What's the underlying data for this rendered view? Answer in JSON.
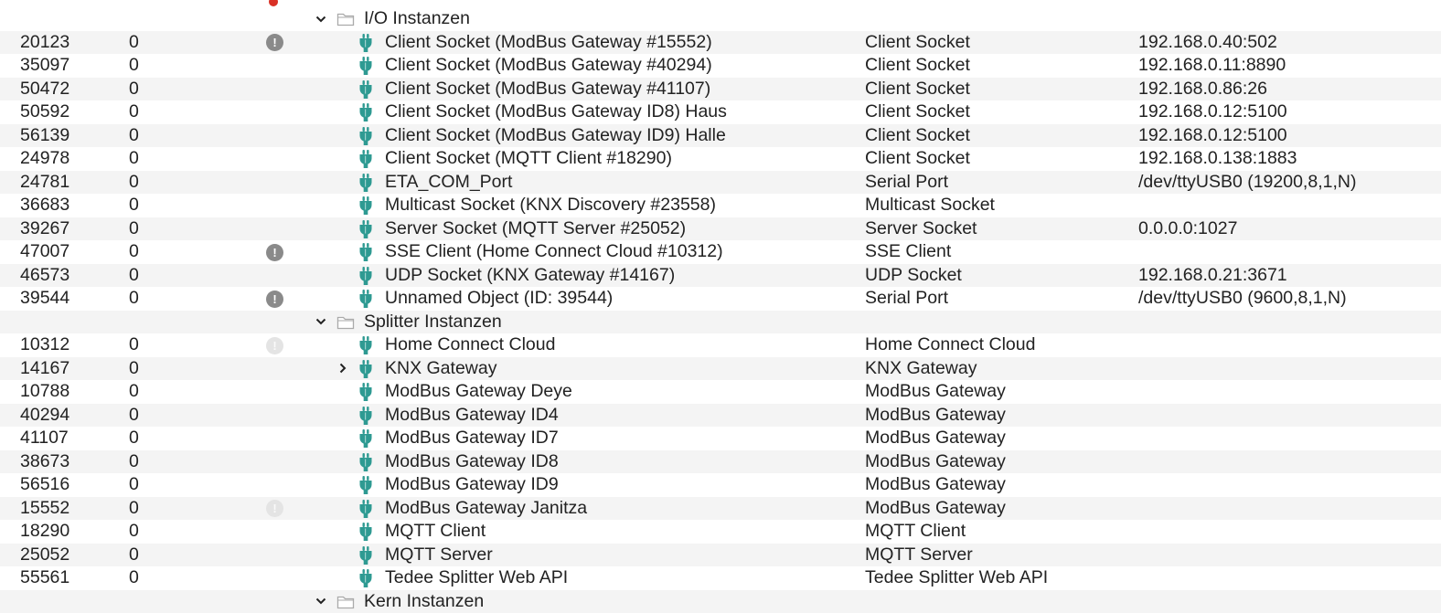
{
  "colors": {
    "plug_icon": "#2e9a92",
    "warn_icon": "#8a8a8a",
    "warn_icon_faded": "#e4e4e4",
    "row_stripe": "#f4f4f4",
    "error_dot": "#d93025"
  },
  "groups": [
    {
      "label": "I/O Instanzen",
      "expanded": true,
      "rows": [
        {
          "id": "20123",
          "count": "0",
          "status": "warning",
          "name": "Client Socket (ModBus Gateway #15552)",
          "type": "Client Socket",
          "address": "192.168.0.40:502"
        },
        {
          "id": "35097",
          "count": "0",
          "status": "none",
          "name": "Client Socket (ModBus Gateway #40294)",
          "type": "Client Socket",
          "address": "192.168.0.11:8890"
        },
        {
          "id": "50472",
          "count": "0",
          "status": "none",
          "name": "Client Socket (ModBus Gateway #41107)",
          "type": "Client Socket",
          "address": "192.168.0.86:26"
        },
        {
          "id": "50592",
          "count": "0",
          "status": "none",
          "name": "Client Socket (ModBus Gateway ID8) Haus",
          "type": "Client Socket",
          "address": "192.168.0.12:5100"
        },
        {
          "id": "56139",
          "count": "0",
          "status": "none",
          "name": "Client Socket (ModBus Gateway ID9) Halle",
          "type": "Client Socket",
          "address": "192.168.0.12:5100"
        },
        {
          "id": "24978",
          "count": "0",
          "status": "none",
          "name": "Client Socket (MQTT Client #18290)",
          "type": "Client Socket",
          "address": "192.168.0.138:1883"
        },
        {
          "id": "24781",
          "count": "0",
          "status": "none",
          "name": "ETA_COM_Port",
          "type": "Serial Port",
          "address": "/dev/ttyUSB0 (19200,8,1,N)"
        },
        {
          "id": "36683",
          "count": "0",
          "status": "none",
          "name": "Multicast Socket (KNX Discovery #23558)",
          "type": "Multicast Socket",
          "address": ""
        },
        {
          "id": "39267",
          "count": "0",
          "status": "none",
          "name": "Server Socket (MQTT Server #25052)",
          "type": "Server Socket",
          "address": "0.0.0.0:1027"
        },
        {
          "id": "47007",
          "count": "0",
          "status": "warning",
          "name": "SSE Client (Home Connect Cloud #10312)",
          "type": "SSE Client",
          "address": ""
        },
        {
          "id": "46573",
          "count": "0",
          "status": "none",
          "name": "UDP Socket (KNX Gateway #14167)",
          "type": "UDP Socket",
          "address": "192.168.0.21:3671"
        },
        {
          "id": "39544",
          "count": "0",
          "status": "warning",
          "name": "Unnamed Object (ID: 39544)",
          "type": "Serial Port",
          "address": "/dev/ttyUSB0 (9600,8,1,N)"
        }
      ]
    },
    {
      "label": "Splitter Instanzen",
      "expanded": true,
      "rows": [
        {
          "id": "10312",
          "count": "0",
          "status": "faded",
          "name": "Home Connect Cloud",
          "type": "Home Connect Cloud",
          "address": ""
        },
        {
          "id": "14167",
          "count": "0",
          "status": "none",
          "expandable": true,
          "name": "KNX Gateway",
          "type": "KNX Gateway",
          "address": ""
        },
        {
          "id": "10788",
          "count": "0",
          "status": "none",
          "name": "ModBus Gateway Deye",
          "type": "ModBus Gateway",
          "address": ""
        },
        {
          "id": "40294",
          "count": "0",
          "status": "none",
          "name": "ModBus Gateway ID4",
          "type": "ModBus Gateway",
          "address": ""
        },
        {
          "id": "41107",
          "count": "0",
          "status": "none",
          "name": "ModBus Gateway ID7",
          "type": "ModBus Gateway",
          "address": ""
        },
        {
          "id": "38673",
          "count": "0",
          "status": "none",
          "name": "ModBus Gateway ID8",
          "type": "ModBus Gateway",
          "address": ""
        },
        {
          "id": "56516",
          "count": "0",
          "status": "none",
          "name": "ModBus Gateway ID9",
          "type": "ModBus Gateway",
          "address": ""
        },
        {
          "id": "15552",
          "count": "0",
          "status": "faded",
          "name": "ModBus Gateway Janitza",
          "type": "ModBus Gateway",
          "address": ""
        },
        {
          "id": "18290",
          "count": "0",
          "status": "none",
          "name": "MQTT Client",
          "type": "MQTT Client",
          "address": ""
        },
        {
          "id": "25052",
          "count": "0",
          "status": "none",
          "name": "MQTT Server",
          "type": "MQTT Server",
          "address": ""
        },
        {
          "id": "55561",
          "count": "0",
          "status": "none",
          "name": "Tedee Splitter Web API",
          "type": "Tedee Splitter Web API",
          "address": ""
        }
      ]
    },
    {
      "label": "Kern Instanzen",
      "expanded": true,
      "rows": []
    }
  ]
}
